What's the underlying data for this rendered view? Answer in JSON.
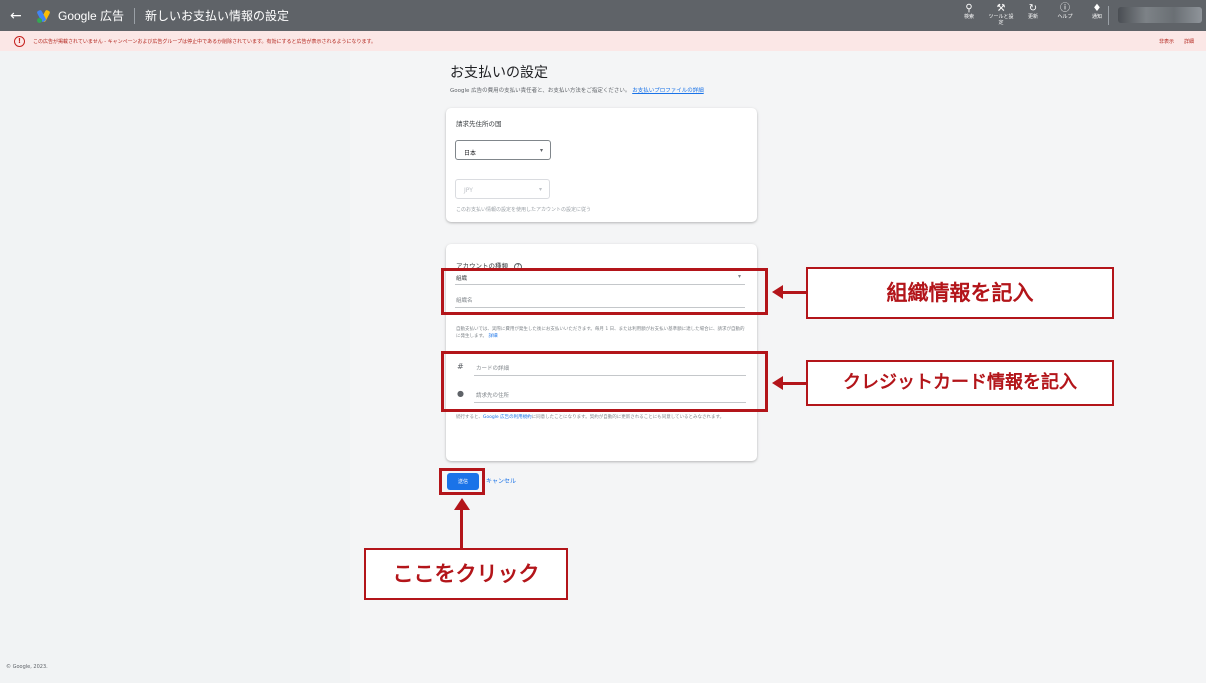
{
  "topbar": {
    "back_icon": "←",
    "brand": "Google 広告",
    "title": "新しいお支払い情報の設定",
    "tools": [
      {
        "icon": "search-icon",
        "glyph": "⚲",
        "label": "検索"
      },
      {
        "icon": "wrench-icon",
        "glyph": "🔧",
        "label": "ツールと設定"
      },
      {
        "icon": "refresh-icon",
        "glyph": "↻",
        "label": "更新"
      },
      {
        "icon": "help-icon",
        "glyph": "?",
        "label": "ヘルプ"
      },
      {
        "icon": "bell-icon",
        "glyph": "🔔",
        "label": "通知"
      }
    ]
  },
  "warning": {
    "icon": "!",
    "text": "この広告が掲載されていません - キャンペーンおよび広告グループは停止中であるか削除されています。有効にすると広告が表示されるようになります。",
    "actions": [
      "非表示",
      "詳細"
    ]
  },
  "page": {
    "heading": "お支払いの設定",
    "subtext": "Google 広告の費用の支払い責任者と、お支払い方法をご指定ください。",
    "subtext_link": "お支払いプロファイルの詳細"
  },
  "billing_country": {
    "label": "請求先住所の国",
    "country_value": "日本",
    "currency_value": "JPY",
    "currency_hint": "このお支払い情報の設定を使用したアカウントの設定に従う"
  },
  "account": {
    "type_label": "アカウントの種類",
    "type_value": "組織",
    "org_name_placeholder": "組織名",
    "auto_pay_text": "自動支払いでは、実際に費用が発生した後にお支払いいただきます。毎月 1 日、または利用額がお支払い基準額に達した場合に、請求が自動的に発生します。",
    "auto_pay_link": "詳細",
    "card_placeholder": "カードの詳細",
    "billing_address_placeholder": "請求先の住所",
    "terms_text_pre": "続行すると、",
    "terms_link": "Google 広告の利用規約",
    "terms_text_post": "に同意したことになります。契約が自動的に更新されることにも同意しているとみなされます。"
  },
  "actions": {
    "submit": "送信",
    "cancel": "キャンセル"
  },
  "annotations": {
    "org_info": "組織情報を記入",
    "credit_card": "クレジットカード情報を記入",
    "click_here": "ここをクリック",
    "color": "#b3151a"
  },
  "footer": "© Google, 2023."
}
